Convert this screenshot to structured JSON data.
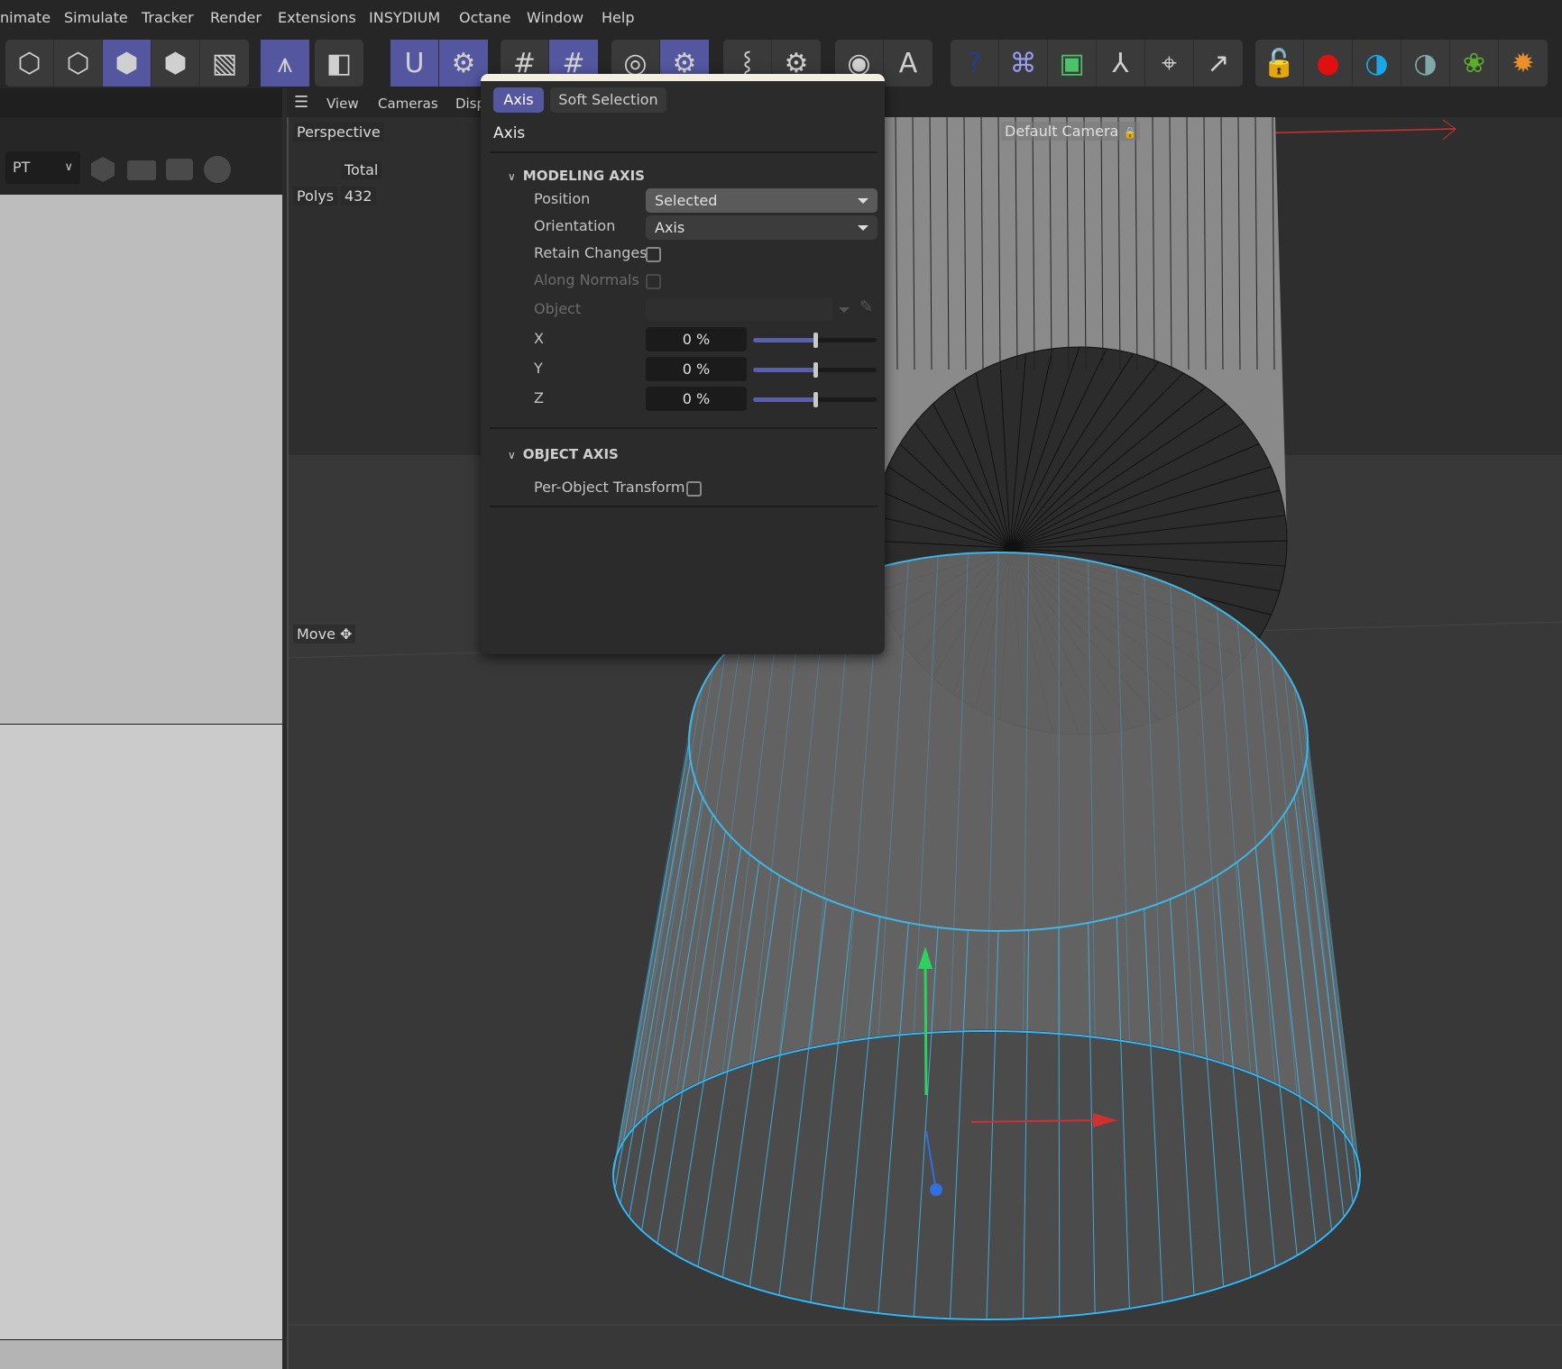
{
  "menu": [
    "nimate",
    "Simulate",
    "Tracker",
    "Render",
    "Extensions",
    "INSYDIUM",
    "Octane",
    "Window",
    "Help"
  ],
  "toolbar": {
    "groups": [
      [
        {
          "icon": "model-mode-icon"
        },
        {
          "icon": "points-mode-icon"
        },
        {
          "icon": "edges-mode-icon",
          "active": true
        },
        {
          "icon": "polygons-mode-icon"
        },
        {
          "icon": "uvw-mode-icon"
        }
      ],
      [
        {
          "icon": "axis-mode-icon",
          "active": true
        }
      ],
      [
        {
          "icon": "solo-mode-icon"
        }
      ],
      [
        {
          "icon": "snap-magnet-icon",
          "active": true
        },
        {
          "icon": "snap-settings-icon",
          "active": true
        }
      ],
      [
        {
          "icon": "workplane-grid-icon"
        },
        {
          "icon": "workplane-align-icon",
          "active": true
        }
      ],
      [
        {
          "icon": "quantize-target-icon"
        },
        {
          "icon": "quantize-settings-icon",
          "active": true
        }
      ],
      [
        {
          "icon": "symmetry-icon"
        },
        {
          "icon": "symmetry-settings-icon"
        }
      ],
      [
        {
          "icon": "view-eye-icon"
        },
        {
          "icon": "text-object-icon"
        }
      ],
      [
        {
          "icon": "help-icon"
        },
        {
          "icon": "python-icon"
        },
        {
          "icon": "green-cube-icon"
        },
        {
          "icon": "branch-icon"
        },
        {
          "icon": "focus-icon"
        },
        {
          "icon": "scale-arrows-icon"
        }
      ],
      [
        {
          "icon": "camera-lock-icon"
        },
        {
          "icon": "render-camera-icon"
        },
        {
          "icon": "contrast-blue-icon"
        },
        {
          "icon": "contrast-gray-icon"
        },
        {
          "icon": "particles-icon"
        },
        {
          "icon": "explosion-icon"
        }
      ]
    ]
  },
  "left_panel": {
    "dropdown_value": "PT"
  },
  "viewport": {
    "menu": [
      "View",
      "Cameras",
      "Disp"
    ],
    "label": "Perspective",
    "stats_header": "Total",
    "stats_label": "Polys",
    "stats_value": "432",
    "tool_label": "Move",
    "camera_label": "Default Camera",
    "colors": {
      "selection": "#3fb6e8",
      "x_axis": "#d03030",
      "y_axis": "#30d060",
      "z_axis": "#3070e0"
    }
  },
  "panel": {
    "tabs": [
      {
        "label": "Axis",
        "active": true
      },
      {
        "label": "Soft Selection",
        "active": false
      }
    ],
    "title": "Axis",
    "modeling_axis": {
      "header": "MODELING AXIS",
      "position_label": "Position",
      "position_value": "Selected",
      "orientation_label": "Orientation",
      "orientation_value": "Axis",
      "retain_changes_label": "Retain Changes",
      "retain_changes_checked": false,
      "along_normals_label": "Along Normals",
      "along_normals_checked": false,
      "object_label": "Object",
      "object_value": "",
      "x_label": "X",
      "x_value": "0 %",
      "x_slider": 0.5,
      "y_label": "Y",
      "y_value": "0 %",
      "y_slider": 0.5,
      "z_label": "Z",
      "z_value": "0 %",
      "z_slider": 0.5
    },
    "object_axis": {
      "header": "OBJECT AXIS",
      "per_object_label": "Per-Object Transform",
      "per_object_checked": false
    }
  }
}
